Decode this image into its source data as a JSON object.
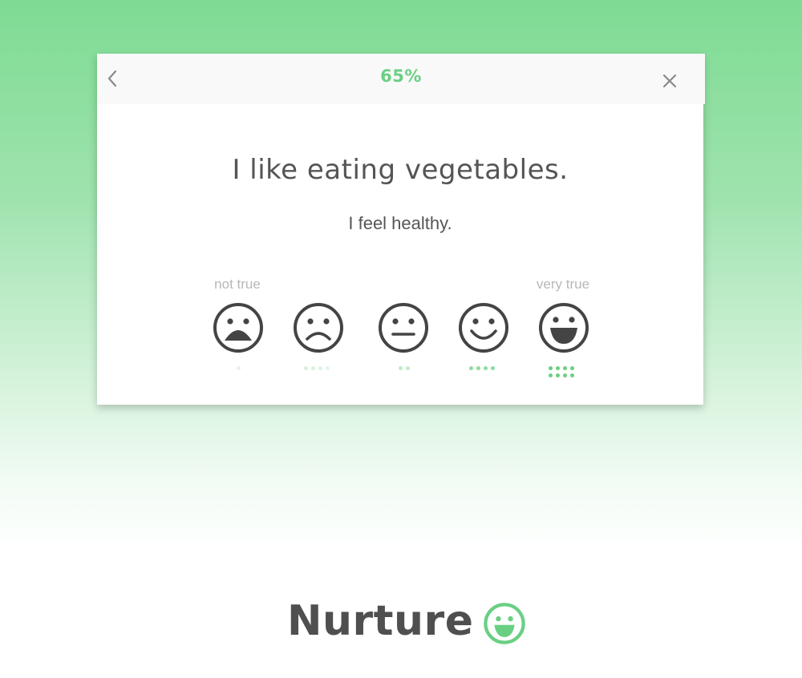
{
  "header": {
    "progress_label": "65%",
    "back_icon": "chevron-left-icon",
    "close_icon": "close-icon"
  },
  "question": {
    "title": "I like eating vegetables.",
    "statement": "I feel healthy."
  },
  "scale": {
    "low_label": "not true",
    "high_label": "very true",
    "options": [
      {
        "icon": "face-shocked-icon",
        "level": 1
      },
      {
        "icon": "face-sad-icon",
        "level": 2
      },
      {
        "icon": "face-neutral-icon",
        "level": 3
      },
      {
        "icon": "face-smile-icon",
        "level": 4
      },
      {
        "icon": "face-laugh-icon",
        "level": 5
      }
    ]
  },
  "brand": {
    "name": "Nurture",
    "logo_icon": "smiley-logo-icon"
  },
  "colors": {
    "accent": "#6acf83",
    "text": "#555555",
    "muted": "#b8b8b8",
    "icon": "#444444"
  }
}
